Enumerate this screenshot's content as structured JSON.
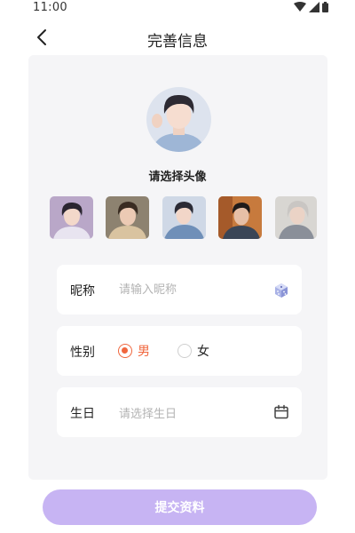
{
  "status_bar": {
    "time": "11:00"
  },
  "nav": {
    "title": "完善信息",
    "back_icon": "chevron-left-icon"
  },
  "avatar": {
    "hint": "请选择头像",
    "options": [
      {
        "name": "avatar-option-1"
      },
      {
        "name": "avatar-option-2"
      },
      {
        "name": "avatar-option-3"
      },
      {
        "name": "avatar-option-4"
      },
      {
        "name": "avatar-option-5"
      }
    ]
  },
  "form": {
    "nickname": {
      "label": "昵称",
      "placeholder": "请输入昵称",
      "value": "",
      "icon": "dice-icon"
    },
    "gender": {
      "label": "性别",
      "options": [
        "男",
        "女"
      ],
      "selected": "男"
    },
    "birthday": {
      "label": "生日",
      "placeholder": "请选择生日",
      "icon": "calendar-icon"
    }
  },
  "submit": {
    "label": "提交资料"
  },
  "colors": {
    "accent": "#f0663d",
    "button": "#c7b4f3",
    "card_bg": "#f5f5f7"
  }
}
